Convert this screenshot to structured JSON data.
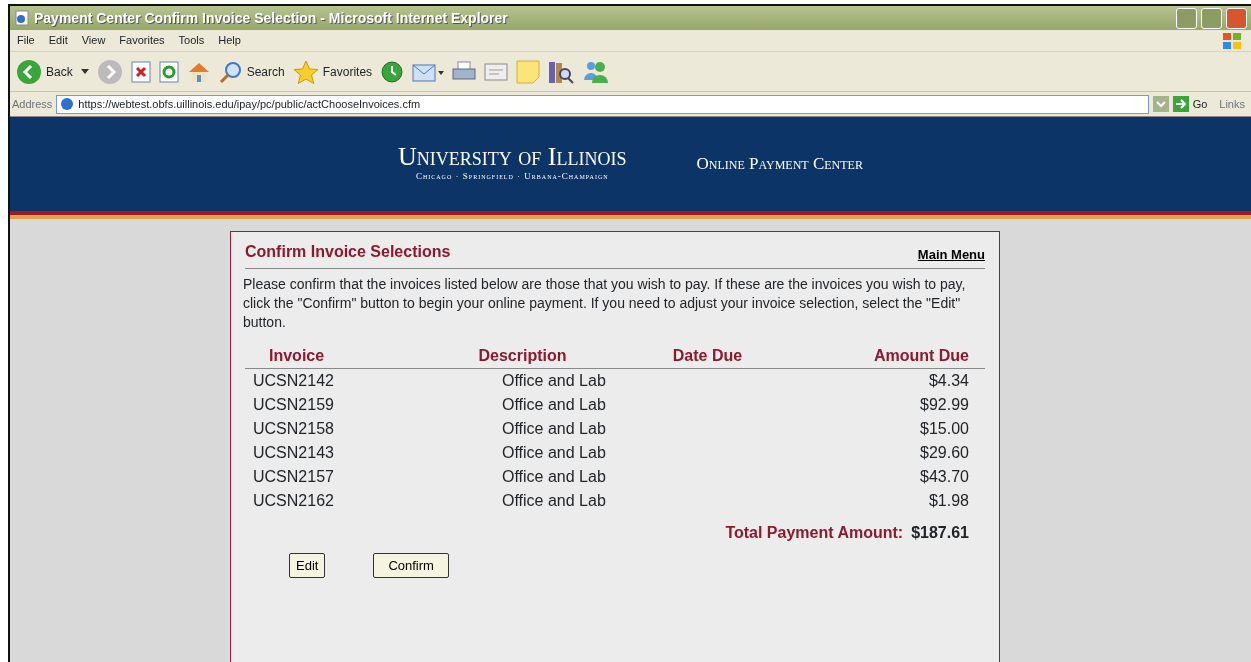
{
  "window": {
    "title": "Payment Center Confirm Invoice Selection - Microsoft Internet Explorer"
  },
  "menu": [
    "File",
    "Edit",
    "View",
    "Favorites",
    "Tools",
    "Help"
  ],
  "toolbar": {
    "back": "Back",
    "search": "Search",
    "favorites": "Favorites"
  },
  "address_bar": {
    "label": "Address",
    "url": "https://webtest.obfs.uillinois.edu/ipay/pc/public/actChooseInvoices.cfm",
    "go": "Go",
    "links": "Links"
  },
  "header": {
    "logo_title": "University of Illinois",
    "logo_subtitle": "Chicago · Springfield · Urbana-Champaign",
    "site_title": "Online Payment Center"
  },
  "card": {
    "title": "Confirm Invoice Selections",
    "main_menu": "Main Menu",
    "intro": "Please confirm that the invoices listed below are those that you wish to pay. If these are the invoices you wish to pay, click the \"Confirm\" button to begin your online payment. If you need to adjust your invoice selection, select the \"Edit\" button.",
    "columns": [
      "Invoice",
      "Description",
      "Date Due",
      "Amount Due"
    ],
    "rows": [
      {
        "invoice": "UCSN2142",
        "description": "Office and Lab",
        "amount": "$4.34"
      },
      {
        "invoice": "UCSN2159",
        "description": "Office and Lab",
        "amount": "$92.99"
      },
      {
        "invoice": "UCSN2158",
        "description": "Office and Lab",
        "amount": "$15.00"
      },
      {
        "invoice": "UCSN2143",
        "description": "Office and Lab",
        "amount": "$29.60"
      },
      {
        "invoice": "UCSN2157",
        "description": "Office and Lab",
        "amount": "$43.70"
      },
      {
        "invoice": "UCSN2162",
        "description": "Office and Lab",
        "amount": "$1.98"
      }
    ],
    "total_label": "Total Payment Amount:",
    "total_value": "$187.61",
    "buttons": [
      "Edit",
      "Confirm"
    ]
  }
}
